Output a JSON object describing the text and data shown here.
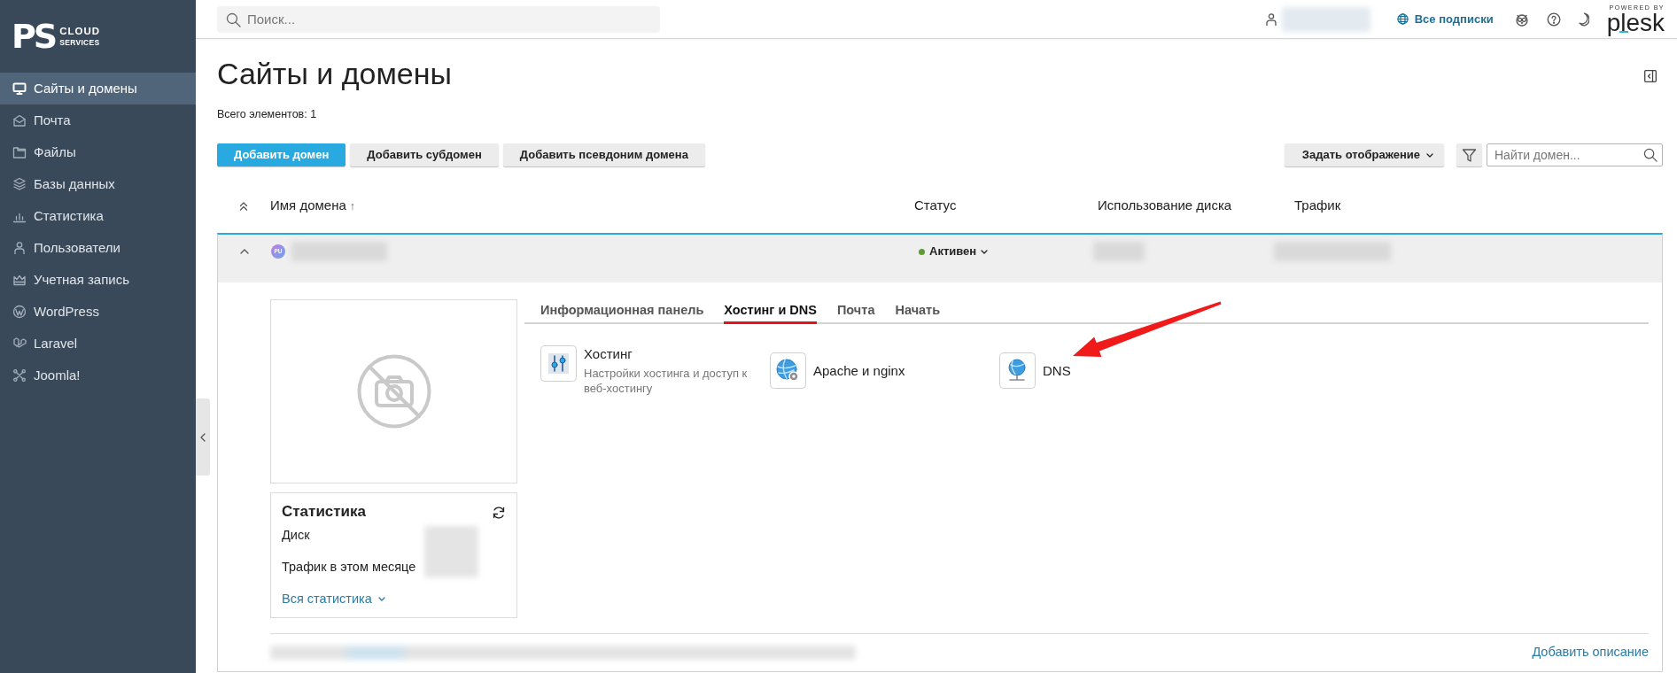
{
  "sidebar": {
    "logo": {
      "mark": "PS",
      "line_1": "CLOUD",
      "line_2": "SERVICES"
    },
    "items": [
      {
        "label": "Сайты и домены",
        "selected": true
      },
      {
        "label": "Почта",
        "selected": false
      },
      {
        "label": "Файлы",
        "selected": false
      },
      {
        "label": "Базы данных",
        "selected": false
      },
      {
        "label": "Статистика",
        "selected": false
      },
      {
        "label": "Пользователи",
        "selected": false
      },
      {
        "label": "Учетная запись",
        "selected": false
      },
      {
        "label": "WordPress",
        "selected": false
      },
      {
        "label": "Laravel",
        "selected": false
      },
      {
        "label": "Joomla!",
        "selected": false
      }
    ]
  },
  "topbar": {
    "search": {
      "placeholder": "Поиск..."
    },
    "subscriptions_link": "Все подписки",
    "brand": {
      "tagline": "POWERED BY",
      "wordmark": "plesk"
    }
  },
  "page": {
    "title": "Сайты и домены",
    "total": "Всего элементов: 1",
    "buttons": [
      {
        "label": "Добавить домен",
        "kind": "primary"
      },
      {
        "label": "Добавить субдомен",
        "kind": "secondary"
      },
      {
        "label": "Добавить псевдоним домена",
        "kind": "secondary"
      }
    ],
    "view_button": "Задать отображение",
    "domain_search": {
      "placeholder": "Найти домен..."
    }
  },
  "table": {
    "columns": [
      {
        "label": "Имя домена",
        "sort": "↑"
      },
      {
        "label": "Статус"
      },
      {
        "label": "Использование диска"
      },
      {
        "label": "Трафик"
      }
    ],
    "rows": [
      {
        "avatar": "PU",
        "expanded": true,
        "status": {
          "label": "Активен",
          "color": "#5a9e2f"
        },
        "tabs": [
          {
            "label": "Информационная панель",
            "selected": false
          },
          {
            "label": "Хостинг и DNS",
            "selected": true
          },
          {
            "label": "Почта",
            "selected": false
          },
          {
            "label": "Начать",
            "selected": false
          }
        ],
        "tools": [
          {
            "title": "Хостинг",
            "description": "Настройки хостинга и доступ к веб-хостингу"
          },
          {
            "title": "Apache и nginx"
          },
          {
            "title": "DNS"
          }
        ],
        "stats": {
          "title": "Статистика",
          "rows": [
            "Диск",
            "Трафик в этом месяце"
          ],
          "link": "Вся статистика"
        },
        "add_description": "Добавить описание"
      }
    ]
  }
}
